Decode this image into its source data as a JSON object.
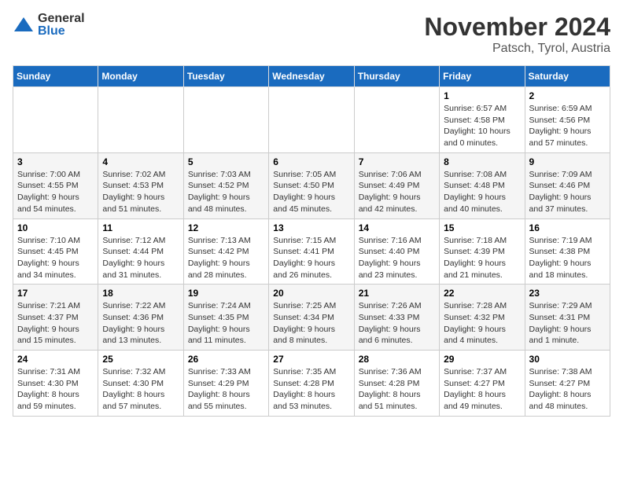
{
  "logo": {
    "general": "General",
    "blue": "Blue"
  },
  "header": {
    "month": "November 2024",
    "location": "Patsch, Tyrol, Austria"
  },
  "weekdays": [
    "Sunday",
    "Monday",
    "Tuesday",
    "Wednesday",
    "Thursday",
    "Friday",
    "Saturday"
  ],
  "weeks": [
    [
      {
        "day": "",
        "info": ""
      },
      {
        "day": "",
        "info": ""
      },
      {
        "day": "",
        "info": ""
      },
      {
        "day": "",
        "info": ""
      },
      {
        "day": "",
        "info": ""
      },
      {
        "day": "1",
        "info": "Sunrise: 6:57 AM\nSunset: 4:58 PM\nDaylight: 10 hours and 0 minutes."
      },
      {
        "day": "2",
        "info": "Sunrise: 6:59 AM\nSunset: 4:56 PM\nDaylight: 9 hours and 57 minutes."
      }
    ],
    [
      {
        "day": "3",
        "info": "Sunrise: 7:00 AM\nSunset: 4:55 PM\nDaylight: 9 hours and 54 minutes."
      },
      {
        "day": "4",
        "info": "Sunrise: 7:02 AM\nSunset: 4:53 PM\nDaylight: 9 hours and 51 minutes."
      },
      {
        "day": "5",
        "info": "Sunrise: 7:03 AM\nSunset: 4:52 PM\nDaylight: 9 hours and 48 minutes."
      },
      {
        "day": "6",
        "info": "Sunrise: 7:05 AM\nSunset: 4:50 PM\nDaylight: 9 hours and 45 minutes."
      },
      {
        "day": "7",
        "info": "Sunrise: 7:06 AM\nSunset: 4:49 PM\nDaylight: 9 hours and 42 minutes."
      },
      {
        "day": "8",
        "info": "Sunrise: 7:08 AM\nSunset: 4:48 PM\nDaylight: 9 hours and 40 minutes."
      },
      {
        "day": "9",
        "info": "Sunrise: 7:09 AM\nSunset: 4:46 PM\nDaylight: 9 hours and 37 minutes."
      }
    ],
    [
      {
        "day": "10",
        "info": "Sunrise: 7:10 AM\nSunset: 4:45 PM\nDaylight: 9 hours and 34 minutes."
      },
      {
        "day": "11",
        "info": "Sunrise: 7:12 AM\nSunset: 4:44 PM\nDaylight: 9 hours and 31 minutes."
      },
      {
        "day": "12",
        "info": "Sunrise: 7:13 AM\nSunset: 4:42 PM\nDaylight: 9 hours and 28 minutes."
      },
      {
        "day": "13",
        "info": "Sunrise: 7:15 AM\nSunset: 4:41 PM\nDaylight: 9 hours and 26 minutes."
      },
      {
        "day": "14",
        "info": "Sunrise: 7:16 AM\nSunset: 4:40 PM\nDaylight: 9 hours and 23 minutes."
      },
      {
        "day": "15",
        "info": "Sunrise: 7:18 AM\nSunset: 4:39 PM\nDaylight: 9 hours and 21 minutes."
      },
      {
        "day": "16",
        "info": "Sunrise: 7:19 AM\nSunset: 4:38 PM\nDaylight: 9 hours and 18 minutes."
      }
    ],
    [
      {
        "day": "17",
        "info": "Sunrise: 7:21 AM\nSunset: 4:37 PM\nDaylight: 9 hours and 15 minutes."
      },
      {
        "day": "18",
        "info": "Sunrise: 7:22 AM\nSunset: 4:36 PM\nDaylight: 9 hours and 13 minutes."
      },
      {
        "day": "19",
        "info": "Sunrise: 7:24 AM\nSunset: 4:35 PM\nDaylight: 9 hours and 11 minutes."
      },
      {
        "day": "20",
        "info": "Sunrise: 7:25 AM\nSunset: 4:34 PM\nDaylight: 9 hours and 8 minutes."
      },
      {
        "day": "21",
        "info": "Sunrise: 7:26 AM\nSunset: 4:33 PM\nDaylight: 9 hours and 6 minutes."
      },
      {
        "day": "22",
        "info": "Sunrise: 7:28 AM\nSunset: 4:32 PM\nDaylight: 9 hours and 4 minutes."
      },
      {
        "day": "23",
        "info": "Sunrise: 7:29 AM\nSunset: 4:31 PM\nDaylight: 9 hours and 1 minute."
      }
    ],
    [
      {
        "day": "24",
        "info": "Sunrise: 7:31 AM\nSunset: 4:30 PM\nDaylight: 8 hours and 59 minutes."
      },
      {
        "day": "25",
        "info": "Sunrise: 7:32 AM\nSunset: 4:30 PM\nDaylight: 8 hours and 57 minutes."
      },
      {
        "day": "26",
        "info": "Sunrise: 7:33 AM\nSunset: 4:29 PM\nDaylight: 8 hours and 55 minutes."
      },
      {
        "day": "27",
        "info": "Sunrise: 7:35 AM\nSunset: 4:28 PM\nDaylight: 8 hours and 53 minutes."
      },
      {
        "day": "28",
        "info": "Sunrise: 7:36 AM\nSunset: 4:28 PM\nDaylight: 8 hours and 51 minutes."
      },
      {
        "day": "29",
        "info": "Sunrise: 7:37 AM\nSunset: 4:27 PM\nDaylight: 8 hours and 49 minutes."
      },
      {
        "day": "30",
        "info": "Sunrise: 7:38 AM\nSunset: 4:27 PM\nDaylight: 8 hours and 48 minutes."
      }
    ]
  ]
}
